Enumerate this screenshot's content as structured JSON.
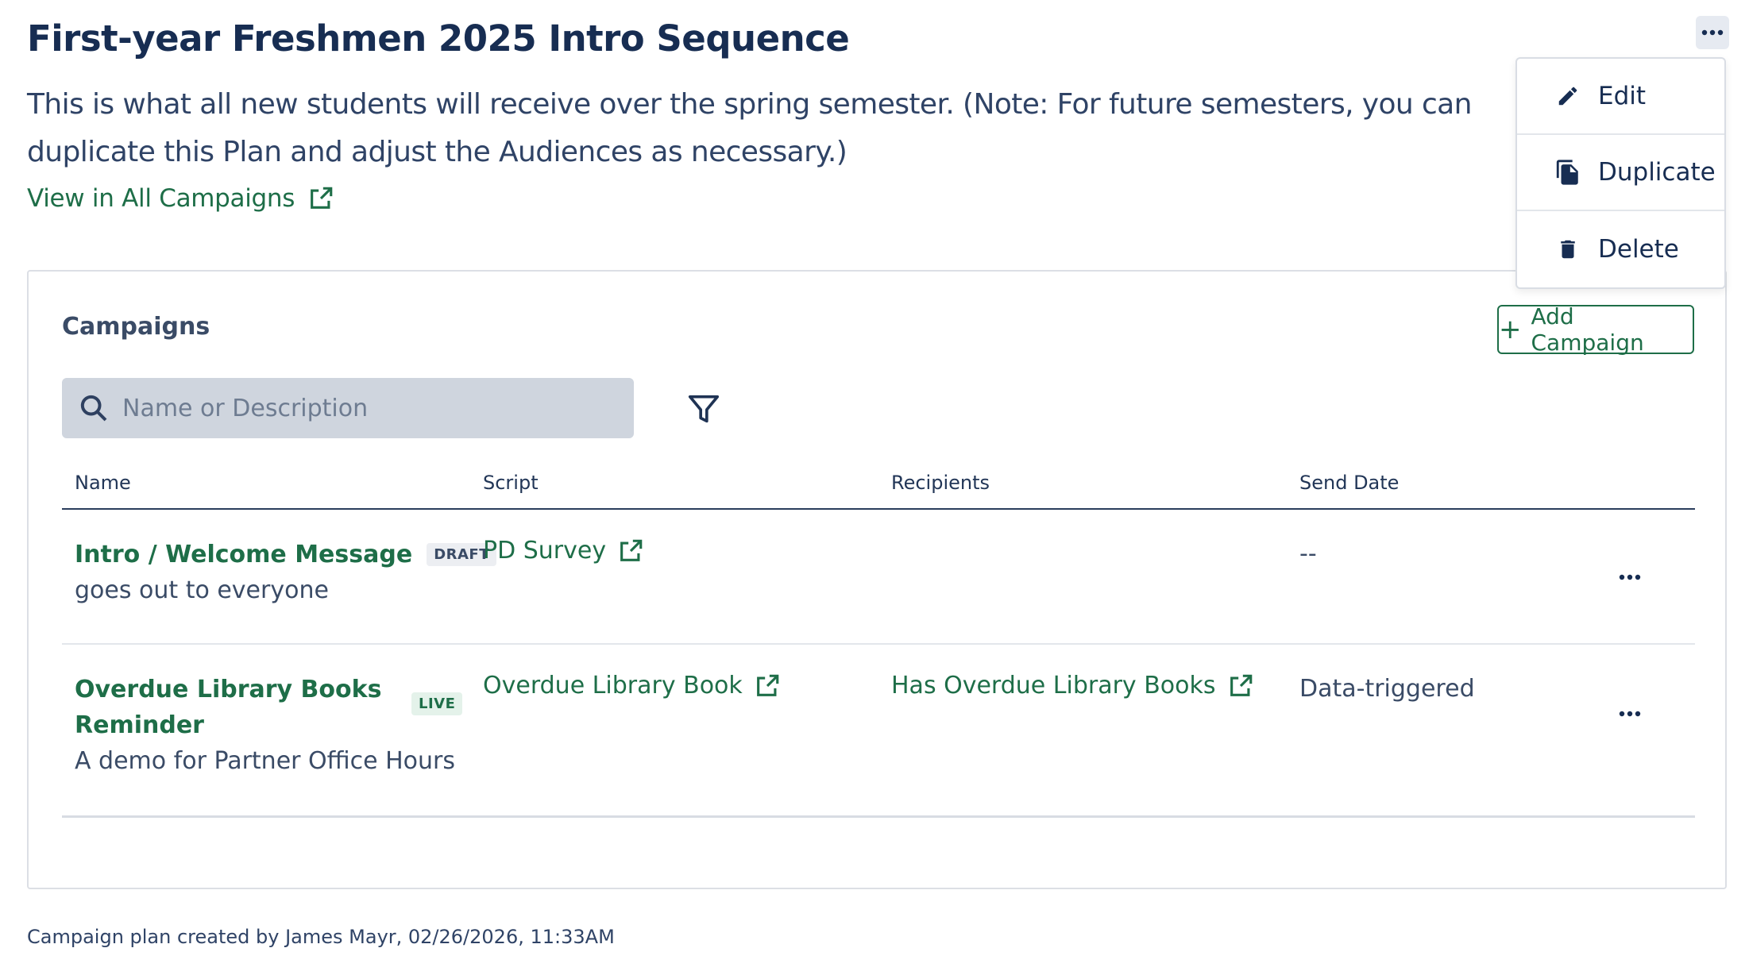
{
  "page": {
    "title": "First-year Freshmen 2025 Intro Sequence",
    "description": "This is what all new students will receive over the spring semester. (Note: For future semesters, you can duplicate this Plan and adjust the Audiences as necessary.)",
    "view_link": "View in All Campaigns"
  },
  "menu": {
    "items": [
      {
        "label": "Edit",
        "icon": "pencil-icon"
      },
      {
        "label": "Duplicate",
        "icon": "copy-icon"
      },
      {
        "label": "Delete",
        "icon": "trash-icon"
      }
    ]
  },
  "campaigns": {
    "title": "Campaigns",
    "add_button": "Add Campaign",
    "search_placeholder": "Name or Description",
    "columns": [
      "Name",
      "Script",
      "Recipients",
      "Send Date"
    ],
    "rows": [
      {
        "name": "Intro / Welcome Message",
        "badge": "DRAFT",
        "description": "goes out to everyone",
        "script": "PD Survey",
        "recipients": "",
        "send_date": "--"
      },
      {
        "name_line1": "Overdue Library Books",
        "name_line2": "Reminder",
        "badge": "LIVE",
        "description": "A demo for Partner Office Hours",
        "script": "Overdue Library Book",
        "recipients": "Has Overdue Library Books",
        "send_date": "Data-triggered"
      }
    ]
  },
  "footer": "Campaign plan created by James Mayr, 02/26/2026, 11:33AM",
  "colors": {
    "primary_green": "#1e6e48",
    "navy": "#172d52",
    "search_bg": "#cfd5de"
  }
}
